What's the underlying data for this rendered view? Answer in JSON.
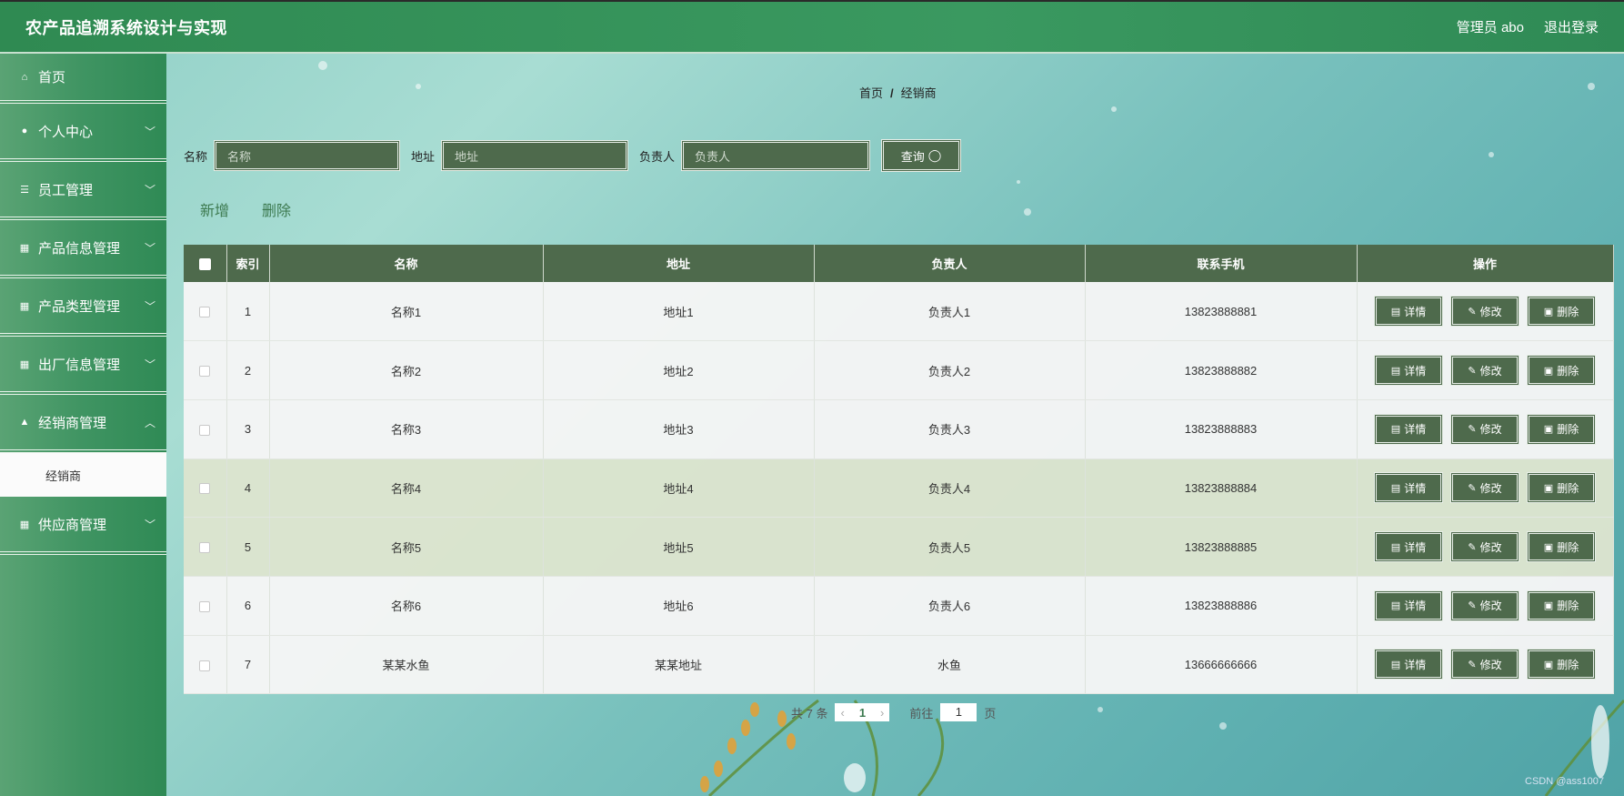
{
  "header": {
    "title": "农产品追溯系统设计与实现",
    "user": "管理员 abo",
    "logout": "退出登录"
  },
  "sidebar": {
    "items": [
      {
        "label": "首页",
        "icon": "home-icon"
      },
      {
        "label": "个人中心",
        "icon": "user-icon"
      },
      {
        "label": "员工管理",
        "icon": "list-icon"
      },
      {
        "label": "产品信息管理",
        "icon": "grid-icon"
      },
      {
        "label": "产品类型管理",
        "icon": "grid-icon"
      },
      {
        "label": "出厂信息管理",
        "icon": "grid-icon"
      },
      {
        "label": "经销商管理",
        "icon": "thumb-icon"
      },
      {
        "label": "供应商管理",
        "icon": "grid-icon"
      }
    ],
    "submenu": {
      "label": "经销商"
    }
  },
  "breadcrumb": {
    "home": "首页",
    "sep": "/",
    "current": "经销商"
  },
  "search": {
    "name_label": "名称",
    "name_placeholder": "名称",
    "address_label": "地址",
    "address_placeholder": "地址",
    "person_label": "负责人",
    "person_placeholder": "负责人",
    "query": "查询"
  },
  "actions": {
    "add": "新增",
    "delete": "删除"
  },
  "table": {
    "headers": [
      "索引",
      "名称",
      "地址",
      "负责人",
      "联系手机",
      "操作"
    ],
    "rows": [
      {
        "idx": "1",
        "name": "名称1",
        "address": "地址1",
        "person": "负责人1",
        "phone": "13823888881"
      },
      {
        "idx": "2",
        "name": "名称2",
        "address": "地址2",
        "person": "负责人2",
        "phone": "13823888882"
      },
      {
        "idx": "3",
        "name": "名称3",
        "address": "地址3",
        "person": "负责人3",
        "phone": "13823888883"
      },
      {
        "idx": "4",
        "name": "名称4",
        "address": "地址4",
        "person": "负责人4",
        "phone": "13823888884"
      },
      {
        "idx": "5",
        "name": "名称5",
        "address": "地址5",
        "person": "负责人5",
        "phone": "13823888885"
      },
      {
        "idx": "6",
        "name": "名称6",
        "address": "地址6",
        "person": "负责人6",
        "phone": "13823888886"
      },
      {
        "idx": "7",
        "name": "某某水鱼",
        "address": "某某地址",
        "person": "水鱼",
        "phone": "13666666666"
      }
    ],
    "ops": {
      "detail": "详情",
      "edit": "修改",
      "remove": "删除"
    }
  },
  "pagination": {
    "total": "共 7 条",
    "current": "1",
    "goto": "前往",
    "goto_value": "1",
    "page_unit": "页"
  },
  "watermark": "CSDN @ass1007"
}
